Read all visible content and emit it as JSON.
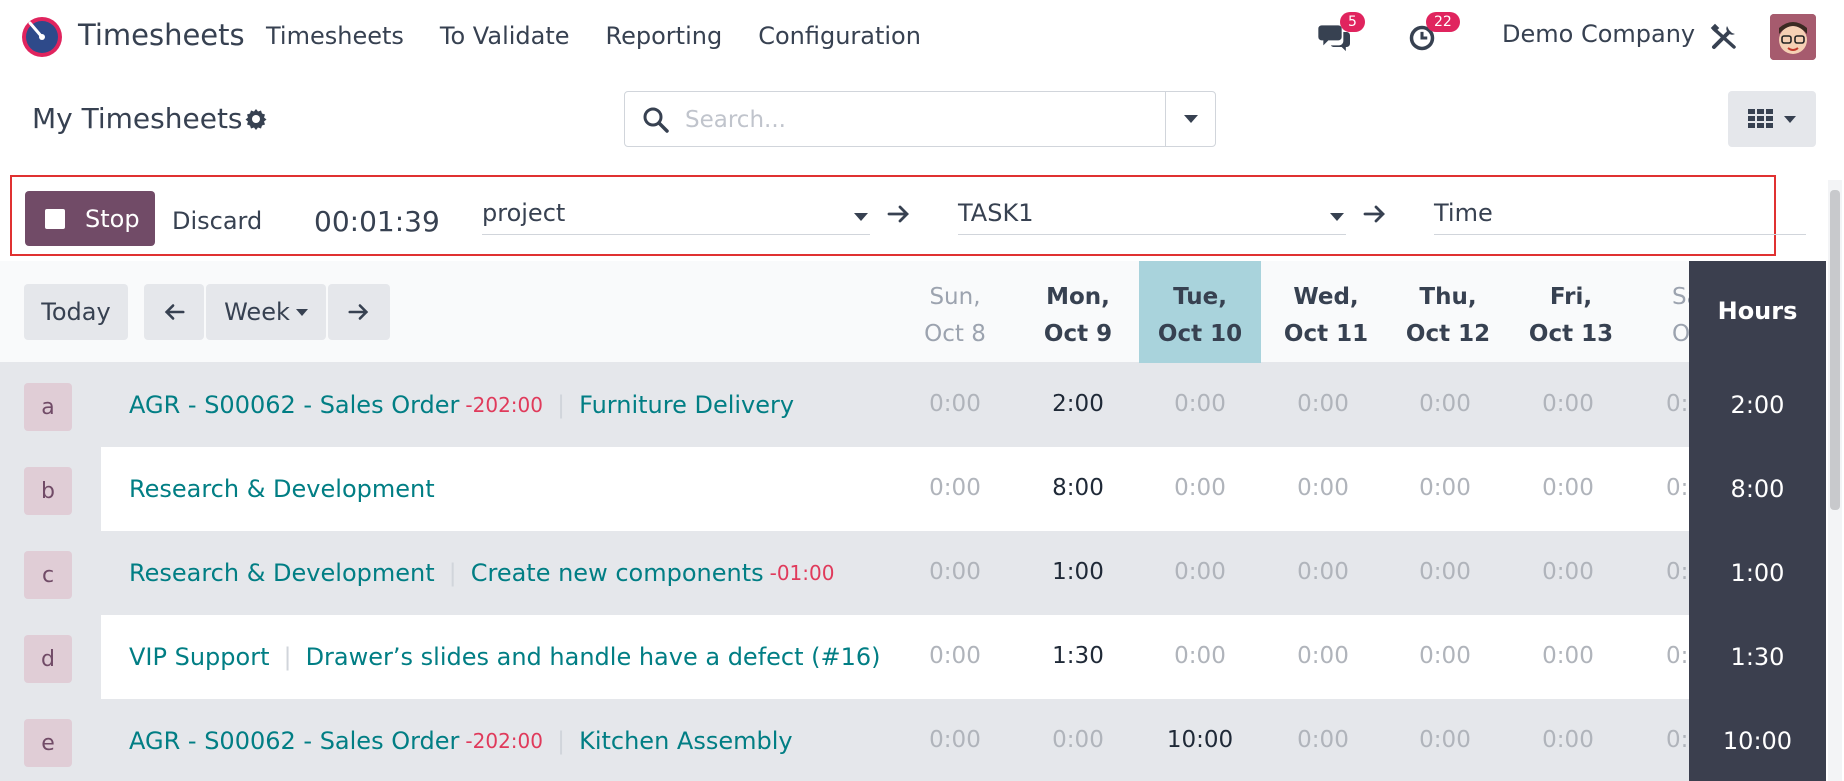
{
  "navbar": {
    "app_name": "Timesheets",
    "menu": [
      "Timesheets",
      "To Validate",
      "Reporting",
      "Configuration"
    ],
    "messages_badge": "5",
    "activities_badge": "22",
    "company": "Demo Company"
  },
  "control": {
    "title": "My Timesheets",
    "search_placeholder": "Search..."
  },
  "timer": {
    "stop_label": "Stop",
    "discard_label": "Discard",
    "elapsed": "00:01:39",
    "project": "project",
    "task": "TASK1",
    "description": "Time"
  },
  "grid": {
    "today_label": "Today",
    "range_label": "Week",
    "hours_label": "Hours",
    "days": [
      {
        "l1": "Sun,",
        "l2": "Oct 8"
      },
      {
        "l1": "Mon,",
        "l2": "Oct 9"
      },
      {
        "l1": "Tue,",
        "l2": "Oct 10"
      },
      {
        "l1": "Wed,",
        "l2": "Oct 11"
      },
      {
        "l1": "Thu,",
        "l2": "Oct 12"
      },
      {
        "l1": "Fri,",
        "l2": "Oct 13"
      },
      {
        "l1": "Sa",
        "l2": "Oc"
      }
    ],
    "rows": [
      {
        "avatar": "a",
        "project": "AGR - S00062 - Sales Order",
        "project_overtime": "-202:00",
        "task": "Furniture Delivery",
        "task_overtime": "",
        "cells": [
          "0:00",
          "2:00",
          "0:00",
          "0:00",
          "0:00",
          "0:00",
          "0:"
        ],
        "total": "2:00"
      },
      {
        "avatar": "b",
        "project": "Research & Development",
        "project_overtime": "",
        "task": "",
        "task_overtime": "",
        "cells": [
          "0:00",
          "8:00",
          "0:00",
          "0:00",
          "0:00",
          "0:00",
          "0:"
        ],
        "total": "8:00"
      },
      {
        "avatar": "c",
        "project": "Research & Development",
        "project_overtime": "",
        "task": "Create new components",
        "task_overtime": "-01:00",
        "cells": [
          "0:00",
          "1:00",
          "0:00",
          "0:00",
          "0:00",
          "0:00",
          "0:"
        ],
        "total": "1:00"
      },
      {
        "avatar": "d",
        "project": "VIP Support",
        "project_overtime": "",
        "task": "Drawer’s slides and handle have a defect (#16)",
        "task_overtime": "",
        "cells": [
          "0:00",
          "1:30",
          "0:00",
          "0:00",
          "0:00",
          "0:00",
          "0:"
        ],
        "total": "1:30"
      },
      {
        "avatar": "e",
        "project": "AGR - S00062 - Sales Order",
        "project_overtime": "-202:00",
        "task": "Kitchen Assembly",
        "task_overtime": "",
        "cells": [
          "0:00",
          "0:00",
          "10:00",
          "0:00",
          "0:00",
          "0:00",
          "0:"
        ],
        "total": "10:00"
      }
    ]
  },
  "colors": {
    "brand": "#714b67",
    "link": "#017e84",
    "negative": "#e03a5b",
    "badge": "#e0245e",
    "hours_bg": "#3b3f4e",
    "today_head": "#a9d3dc",
    "today_shaded": "#c9e1e6",
    "today_white": "#dff4f7"
  },
  "icons": [
    "odoo-timesheets-logo",
    "chat-icon",
    "clock-icon",
    "tools-icon",
    "gear-icon",
    "search-icon",
    "grid-view-icon",
    "arrow-right-icon"
  ]
}
